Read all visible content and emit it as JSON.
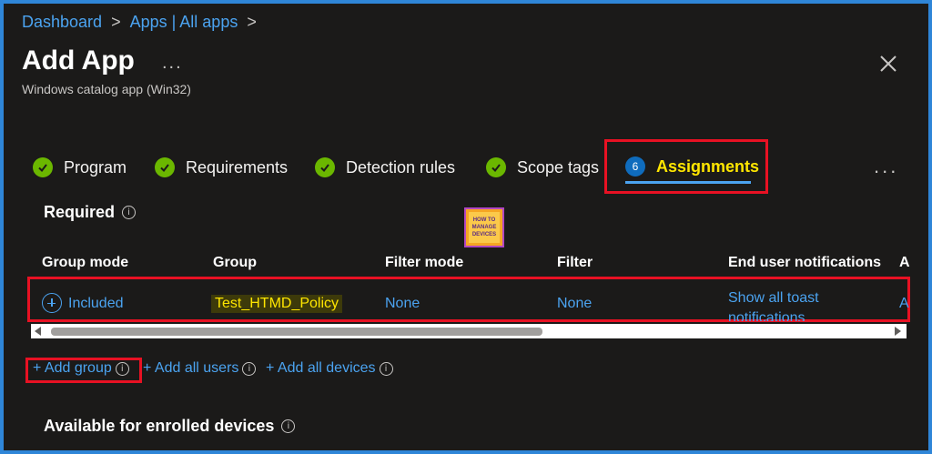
{
  "breadcrumb": {
    "item1": "Dashboard",
    "item2": "Apps | All apps",
    "sep": ">"
  },
  "header": {
    "title": "Add App",
    "more": "...",
    "subtitle": "Windows catalog app (Win32)"
  },
  "tabs": [
    {
      "label": "Program",
      "state": "complete"
    },
    {
      "label": "Requirements",
      "state": "complete"
    },
    {
      "label": "Detection rules",
      "state": "complete"
    },
    {
      "label": "Scope tags",
      "state": "complete"
    },
    {
      "label": "Assignments",
      "state": "active",
      "number": "6"
    }
  ],
  "tabs_more": "...",
  "required": {
    "heading": "Required",
    "info": "i"
  },
  "logo": {
    "text": "HOW TO MANAGE DEVICES"
  },
  "table": {
    "headers": [
      "Group mode",
      "Group",
      "Filter mode",
      "Filter",
      "End user notifications",
      "A"
    ],
    "row": {
      "group_mode": "Included",
      "group": "Test_HTMD_Policy",
      "filter_mode": "None",
      "filter": "None",
      "notifications_line1": "Show all toast",
      "notifications_line2": "notifications",
      "overflow": "A"
    }
  },
  "actions": {
    "add_group": "+ Add group",
    "add_all_users": "+ Add all users",
    "add_all_devices": "+ Add all devices",
    "info": "i"
  },
  "available": {
    "heading": "Available for enrolled devices",
    "info": "i"
  },
  "colors": {
    "accent": "#4ba3f0",
    "highlight": "#e81123",
    "check": "#6bb700",
    "active_label": "#ffe600"
  }
}
